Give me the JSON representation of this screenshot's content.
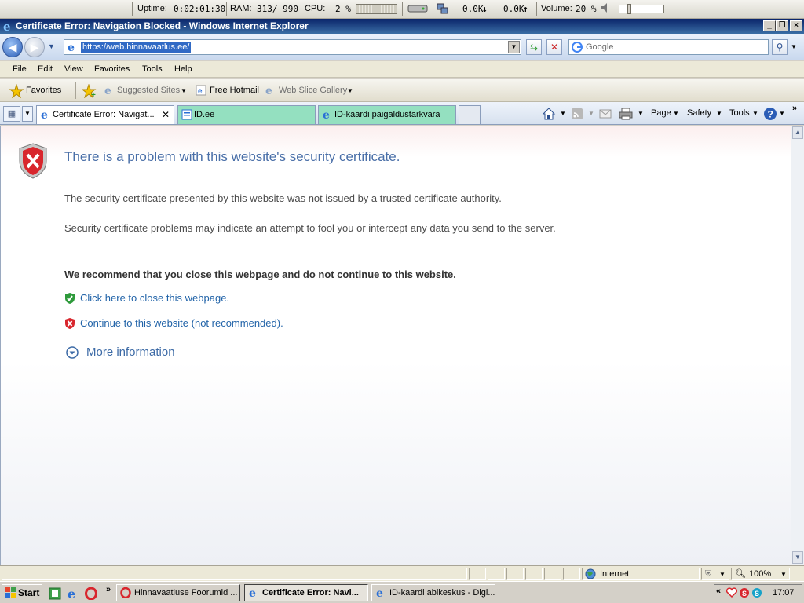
{
  "sysmon": {
    "uptime_label": "Uptime:",
    "uptime": "0:02:01:30",
    "ram_label": "RAM:",
    "ram": "313/ 990",
    "cpu_label": "CPU:",
    "cpu": "2 %",
    "net_down": "0.0K",
    "net_up": "0.0K",
    "volume_label": "Volume:",
    "volume": "20 %"
  },
  "window": {
    "title": "Certificate Error: Navigation Blocked - Windows Internet Explorer"
  },
  "address": {
    "url": "https://web.hinnavaatlus.ee/",
    "search_placeholder": "Google"
  },
  "menu": [
    "File",
    "Edit",
    "View",
    "Favorites",
    "Tools",
    "Help"
  ],
  "favorites_bar": {
    "favorites": "Favorites",
    "suggested": "Suggested Sites",
    "hotmail": "Free Hotmail",
    "webslice": "Web Slice Gallery"
  },
  "tabs": [
    {
      "label": "Certificate Error: Navigat...",
      "active": true
    },
    {
      "label": "ID.ee",
      "active": false
    },
    {
      "label": "ID-kaardi paigaldustarkvara",
      "active": false
    }
  ],
  "command_bar": {
    "page": "Page",
    "safety": "Safety",
    "tools": "Tools"
  },
  "page": {
    "heading": "There is a problem with this website's security certificate.",
    "para1": "The security certificate presented by this website was not issued by a trusted certificate authority.",
    "para2": "Security certificate problems may indicate an attempt to fool you or intercept any data you send to the server.",
    "recommend": "We recommend that you close this webpage and do not continue to this website.",
    "close_link": "Click here to close this webpage.",
    "continue_link": "Continue to this website (not recommended).",
    "more_info": "More information"
  },
  "status": {
    "zone": "Internet",
    "zoom": "100%"
  },
  "taskbar": {
    "start": "Start",
    "items": [
      {
        "label": "Hinnavaatluse Foorumid ..."
      },
      {
        "label": "Certificate Error: Navi..."
      },
      {
        "label": "ID-kaardi abikeskus - Digi..."
      }
    ],
    "clock": "17:07"
  }
}
